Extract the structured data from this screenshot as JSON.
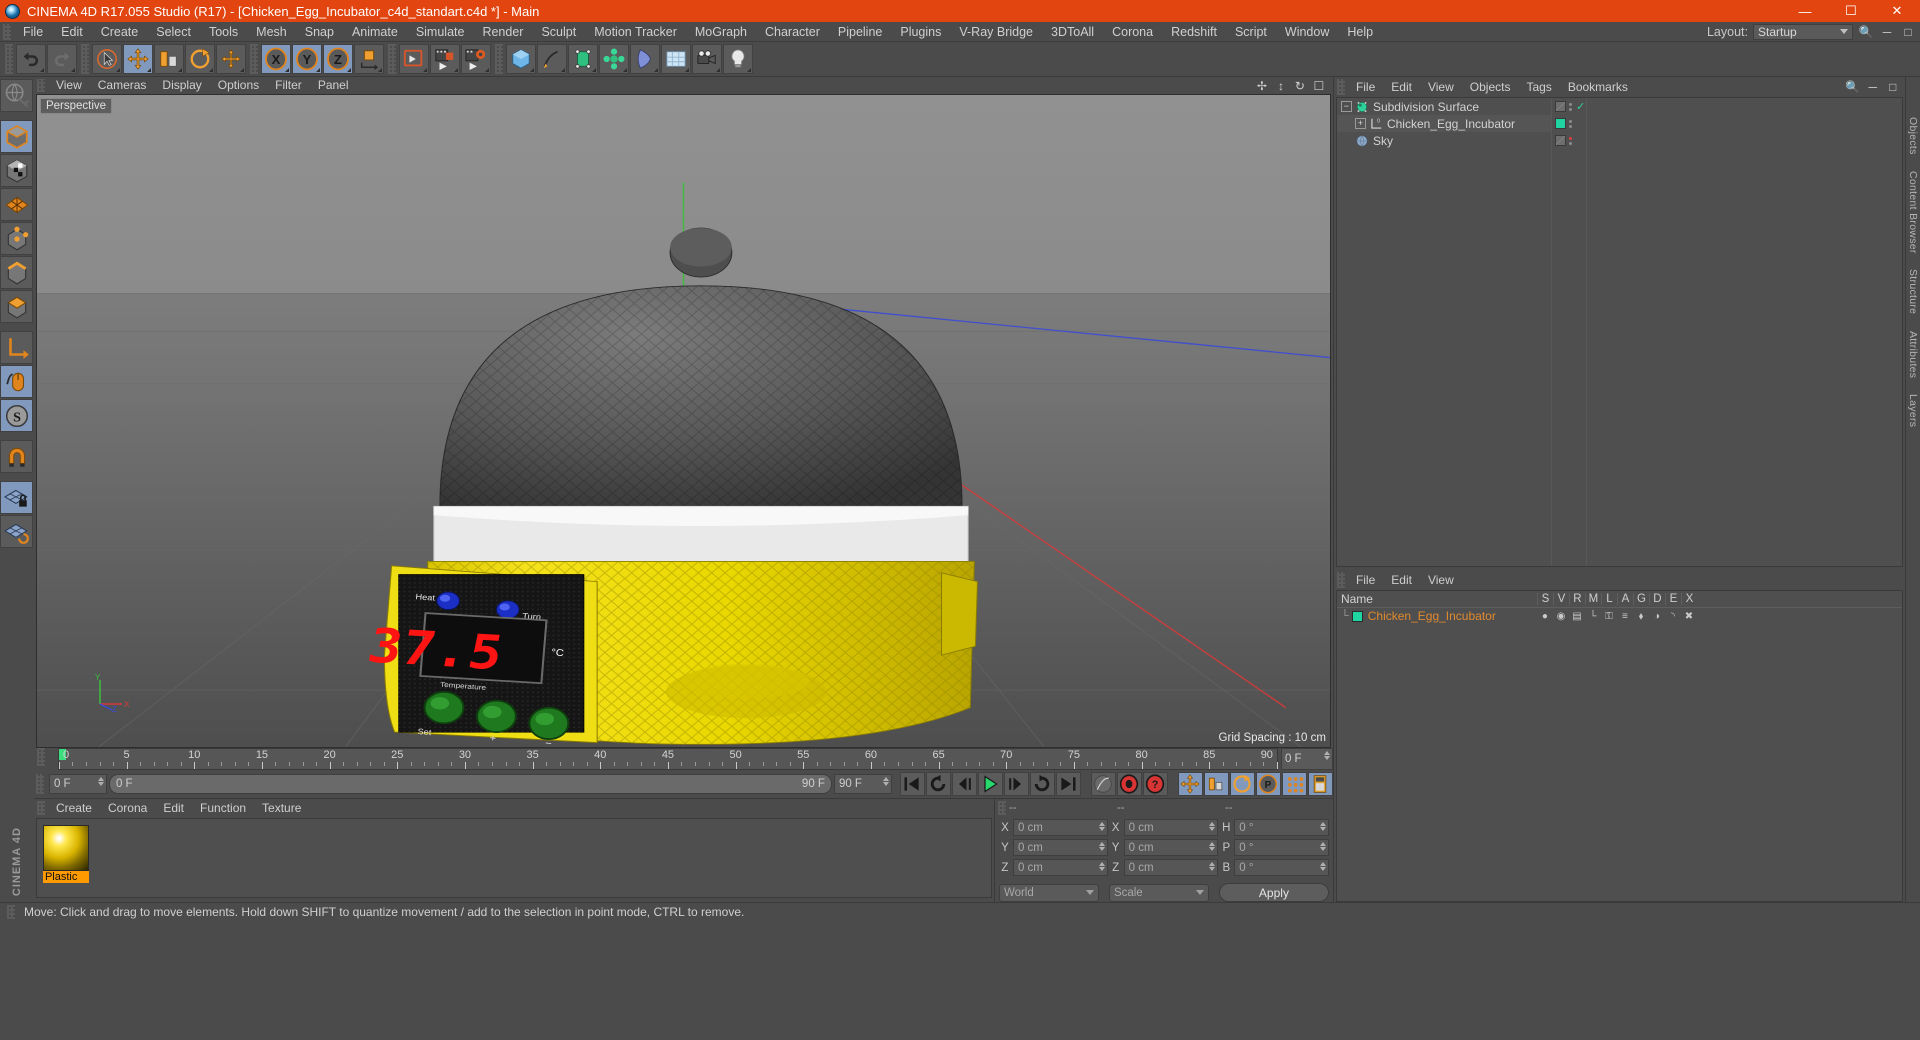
{
  "titlebar": {
    "title": "CINEMA 4D R17.055 Studio (R17) - [Chicken_Egg_Incubator_c4d_standart.c4d *] - Main",
    "minimize": "—",
    "maximize": "☐",
    "close": "✕"
  },
  "menubar": {
    "items": [
      {
        "label": "File"
      },
      {
        "label": "Edit"
      },
      {
        "label": "Create"
      },
      {
        "label": "Select"
      },
      {
        "label": "Tools"
      },
      {
        "label": "Mesh"
      },
      {
        "label": "Snap"
      },
      {
        "label": "Animate"
      },
      {
        "label": "Simulate"
      },
      {
        "label": "Render"
      },
      {
        "label": "Sculpt"
      },
      {
        "label": "Motion Tracker"
      },
      {
        "label": "MoGraph"
      },
      {
        "label": "Character"
      },
      {
        "label": "Pipeline"
      },
      {
        "label": "Plugins"
      },
      {
        "label": "V-Ray Bridge"
      },
      {
        "label": "3DToAll"
      },
      {
        "label": "Corona"
      },
      {
        "label": "Redshift"
      },
      {
        "label": "Script"
      },
      {
        "label": "Window"
      },
      {
        "label": "Help"
      }
    ],
    "layout_label": "Layout:",
    "layout_value": "Startup"
  },
  "toolbar": {
    "groups": [
      {
        "name": "history",
        "buttons": [
          {
            "name": "undo-button",
            "icon": "undo"
          },
          {
            "name": "redo-button",
            "icon": "redo"
          }
        ]
      },
      {
        "name": "transform",
        "buttons": [
          {
            "name": "live-selection-button",
            "icon": "cursor"
          },
          {
            "name": "move-tool-button",
            "icon": "move",
            "active": true
          },
          {
            "name": "scale-tool-button",
            "icon": "scale"
          },
          {
            "name": "rotate-tool-button",
            "icon": "rotate"
          },
          {
            "name": "move-alt-button",
            "icon": "move-alt"
          }
        ]
      },
      {
        "name": "axis-lock",
        "buttons": [
          {
            "name": "lock-x-button",
            "icon": "X",
            "active": true
          },
          {
            "name": "lock-y-button",
            "icon": "Y",
            "active": true
          },
          {
            "name": "lock-z-button",
            "icon": "Z",
            "active": true
          },
          {
            "name": "world-object-axis-button",
            "icon": "world-axis"
          }
        ]
      },
      {
        "name": "render",
        "buttons": [
          {
            "name": "render-view-button",
            "icon": "render-view"
          },
          {
            "name": "render-to-picture-viewer-button",
            "icon": "render-pv"
          },
          {
            "name": "render-settings-button",
            "icon": "render-settings"
          }
        ]
      },
      {
        "name": "objects",
        "buttons": [
          {
            "name": "add-cube-button",
            "icon": "cube"
          },
          {
            "name": "add-spline-button",
            "icon": "pen"
          },
          {
            "name": "add-nurbs-button",
            "icon": "nurbs"
          },
          {
            "name": "add-array-button",
            "icon": "array"
          },
          {
            "name": "add-deformer-button",
            "icon": "deformer"
          },
          {
            "name": "add-environment-button",
            "icon": "environment"
          },
          {
            "name": "add-camera-button",
            "icon": "camera"
          },
          {
            "name": "add-light-button",
            "icon": "light"
          }
        ]
      }
    ]
  },
  "left_toolbar": {
    "buttons": [
      {
        "name": "make-editable-button",
        "icon": "globe-editable"
      },
      {
        "name": "model-mode-button",
        "icon": "model-cube",
        "active": true
      },
      {
        "name": "texture-mode-button",
        "icon": "texture-cube"
      },
      {
        "name": "points-mode-button",
        "icon": "grid-points"
      },
      {
        "name": "point-mode-button",
        "icon": "cube-points"
      },
      {
        "name": "edge-mode-button",
        "icon": "cube-edge"
      },
      {
        "name": "polygon-mode-button",
        "icon": "cube-poly"
      },
      {
        "name": "axis-modify-button",
        "icon": "axis"
      },
      {
        "name": "viewport-solo-button",
        "icon": "mouse",
        "active": true
      },
      {
        "name": "workplane-button",
        "icon": "s-circle",
        "active": true
      },
      {
        "name": "magnet-button",
        "icon": "magnet"
      },
      {
        "name": "lock-workplane-button",
        "icon": "grid-lock",
        "active": true
      },
      {
        "name": "planar-workplane-button",
        "icon": "grid-rotate"
      }
    ],
    "brand": "CINEMA 4D"
  },
  "viewport": {
    "menus": [
      {
        "label": "View"
      },
      {
        "label": "Cameras"
      },
      {
        "label": "Display"
      },
      {
        "label": "Options"
      },
      {
        "label": "Filter"
      },
      {
        "label": "Panel"
      }
    ],
    "tag": "Perspective",
    "grid_spacing": "Grid Spacing : 10 cm",
    "axis_labels": {
      "x": "X",
      "y": "Y",
      "z": "Z"
    },
    "model": {
      "name": "Chicken Egg Incubator",
      "dome_color": "#5a5a5a",
      "band_color": "#e6e6e6",
      "base_color": "#f2dc12",
      "panel_color": "#141414",
      "led_value": "37.5",
      "led_unit": "°C",
      "led_color": "#ff1010",
      "panel_label_left": "Heat",
      "panel_label_right": "Turn",
      "panel_label_display": "Temperature",
      "button_labels": [
        "Set",
        "+",
        "−"
      ],
      "button_color": "#1f7a1f"
    }
  },
  "timeline": {
    "start_frame": "0 F",
    "current_frame": "0 F",
    "end_frame": "90 F",
    "range_left": "0 F",
    "range_right": "90 F",
    "ticks": [
      0,
      5,
      10,
      15,
      20,
      25,
      30,
      35,
      40,
      45,
      50,
      55,
      60,
      65,
      70,
      75,
      80,
      85,
      90
    ],
    "playback_buttons": [
      {
        "name": "go-to-start-button",
        "icon": "skip-start"
      },
      {
        "name": "play-backwards-button",
        "icon": "loop-back"
      },
      {
        "name": "previous-frame-button",
        "icon": "step-back"
      },
      {
        "name": "play-button",
        "icon": "play"
      },
      {
        "name": "next-frame-button",
        "icon": "step-fwd"
      },
      {
        "name": "play-forward-loop-button",
        "icon": "loop-fwd"
      },
      {
        "name": "go-to-end-button",
        "icon": "skip-end"
      }
    ],
    "record_buttons": [
      {
        "name": "autokeying-button",
        "icon": "auto-key"
      },
      {
        "name": "record-active-objects-button",
        "icon": "record"
      },
      {
        "name": "keyframe-selection-button",
        "icon": "key-question"
      }
    ],
    "key_toggle_buttons": [
      {
        "name": "position-key-button",
        "icon": "pos",
        "active": true
      },
      {
        "name": "scale-key-button",
        "icon": "scl",
        "active": true
      },
      {
        "name": "rotation-key-button",
        "icon": "rot",
        "active": true
      },
      {
        "name": "parameter-key-button",
        "icon": "param",
        "active": true
      },
      {
        "name": "point-level-animation-button",
        "icon": "pla",
        "active": true
      },
      {
        "name": "keyframe-mode-button",
        "icon": "keymode",
        "active": true
      }
    ]
  },
  "material_manager": {
    "menus": [
      {
        "label": "Create"
      },
      {
        "label": "Corona"
      },
      {
        "label": "Edit"
      },
      {
        "label": "Function"
      },
      {
        "label": "Texture"
      }
    ],
    "materials": [
      {
        "name": "Plastic"
      }
    ]
  },
  "coordinates": {
    "headers": [
      "--",
      "--",
      "--"
    ],
    "rows": [
      {
        "pos_label": "X",
        "pos_value": "0 cm",
        "size_label": "X",
        "size_value": "0 cm",
        "rot_label": "H",
        "rot_value": "0 °"
      },
      {
        "pos_label": "Y",
        "pos_value": "0 cm",
        "size_label": "Y",
        "size_value": "0 cm",
        "rot_label": "P",
        "rot_value": "0 °"
      },
      {
        "pos_label": "Z",
        "pos_value": "0 cm",
        "size_label": "Z",
        "size_value": "0 cm",
        "rot_label": "B",
        "rot_value": "0 °"
      }
    ],
    "coord_system": "World",
    "transform_mode": "Scale",
    "apply_label": "Apply"
  },
  "object_manager": {
    "menus": [
      {
        "label": "File"
      },
      {
        "label": "Edit"
      },
      {
        "label": "View"
      },
      {
        "label": "Objects"
      },
      {
        "label": "Tags"
      },
      {
        "label": "Bookmarks"
      }
    ],
    "objects": [
      {
        "name": "Subdivision Surface",
        "indent": 0,
        "icon": "subdivision-surface",
        "expander": "−",
        "tag_state": "checked"
      },
      {
        "name": "Chicken_Egg_Incubator",
        "indent": 1,
        "icon": "null-object",
        "expander": "+",
        "tag_state": "material"
      },
      {
        "name": "Sky",
        "indent": 0,
        "icon": "sky",
        "expander": "",
        "tag_state": "red"
      }
    ]
  },
  "layer_manager": {
    "menus": [
      {
        "label": "File"
      },
      {
        "label": "Edit"
      },
      {
        "label": "View"
      }
    ],
    "columns": [
      "Name",
      "S",
      "V",
      "R",
      "M",
      "L",
      "A",
      "G",
      "D",
      "E",
      "X"
    ],
    "rows": [
      {
        "name": "Chicken_Egg_Incubator",
        "color": "#1fd4a0"
      }
    ]
  },
  "right_tabs": [
    {
      "label": "Objects"
    },
    {
      "label": "Content Browser"
    },
    {
      "label": "Structure"
    },
    {
      "label": "Attributes"
    },
    {
      "label": "Layers"
    }
  ],
  "status_bar": {
    "message": "Move: Click and drag to move elements. Hold down SHIFT to quantize movement / add to the selection in point mode, CTRL to remove."
  }
}
